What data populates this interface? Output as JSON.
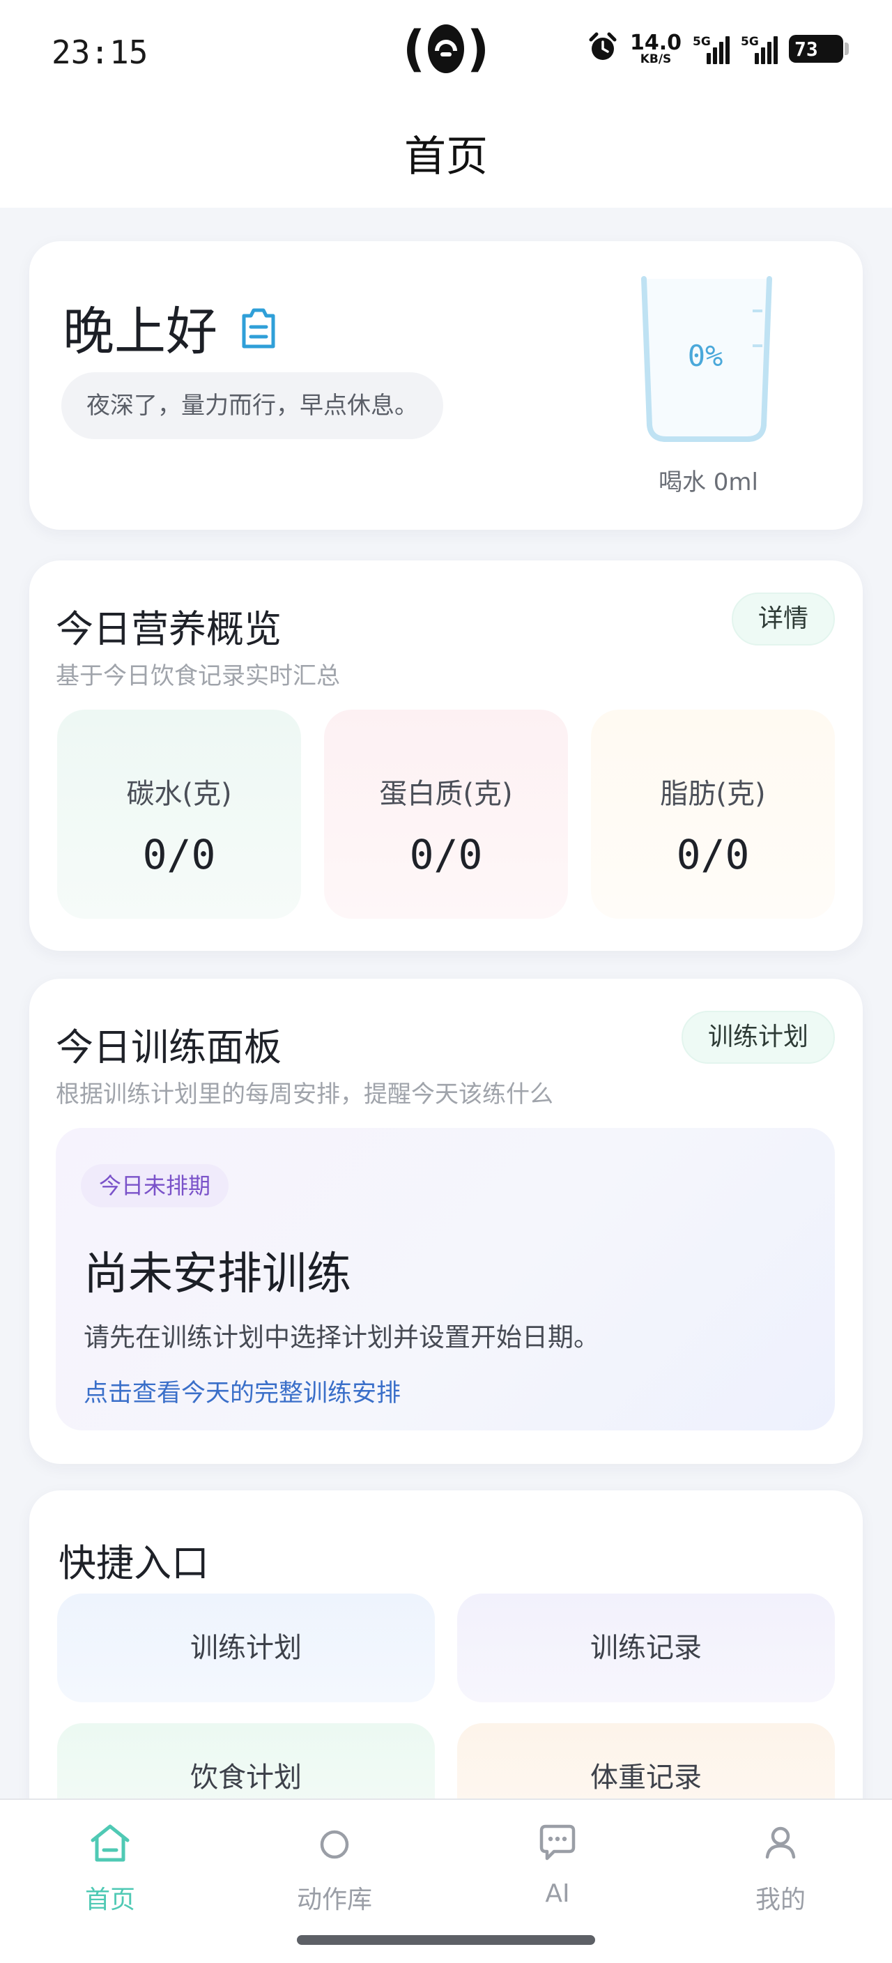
{
  "status_bar": {
    "time": "23:15",
    "net_speed_value": "14.0",
    "net_speed_unit": "KB/S",
    "signal1_tag": "5G",
    "signal2_tag": "5G",
    "battery": "73",
    "icons": [
      "hotspot-icon",
      "alarm-icon",
      "signal-icon",
      "battery-icon"
    ]
  },
  "header": {
    "title": "首页"
  },
  "greeting": {
    "title": "晚上好",
    "subtitle": "夜深了，量力而行，早点休息。",
    "water_percent": "0%",
    "water_label": "喝水 0ml",
    "water_level": 0
  },
  "nutrition": {
    "title": "今日营养概览",
    "subtitle": "基于今日饮食记录实时汇总",
    "detail_button": "详情",
    "macros": [
      {
        "label": "碳水(克)",
        "value": "0/0"
      },
      {
        "label": "蛋白质(克)",
        "value": "0/0"
      },
      {
        "label": "脂肪(克)",
        "value": "0/0"
      }
    ]
  },
  "training": {
    "title": "今日训练面板",
    "subtitle": "根据训练计划里的每周安排，提醒今天该练什么",
    "plan_button": "训练计划",
    "badge": "今日未排期",
    "headline": "尚未安排训练",
    "description": "请先在训练计划中选择计划并设置开始日期。",
    "link": "点击查看今天的完整训练安排"
  },
  "quick_entry": {
    "title": "快捷入口",
    "items": [
      {
        "label": "训练计划"
      },
      {
        "label": "训练记录"
      },
      {
        "label": "饮食计划"
      },
      {
        "label": "体重记录"
      }
    ]
  },
  "tab_bar": {
    "tabs": [
      {
        "label": "首页",
        "icon": "home-icon",
        "active": true
      },
      {
        "label": "动作库",
        "icon": "circle-icon",
        "active": false
      },
      {
        "label": "AI",
        "icon": "chat-icon",
        "active": false
      },
      {
        "label": "我的",
        "icon": "user-icon",
        "active": false
      }
    ],
    "active_color": "#4fc9b4",
    "inactive_color": "#9a9ea6"
  }
}
